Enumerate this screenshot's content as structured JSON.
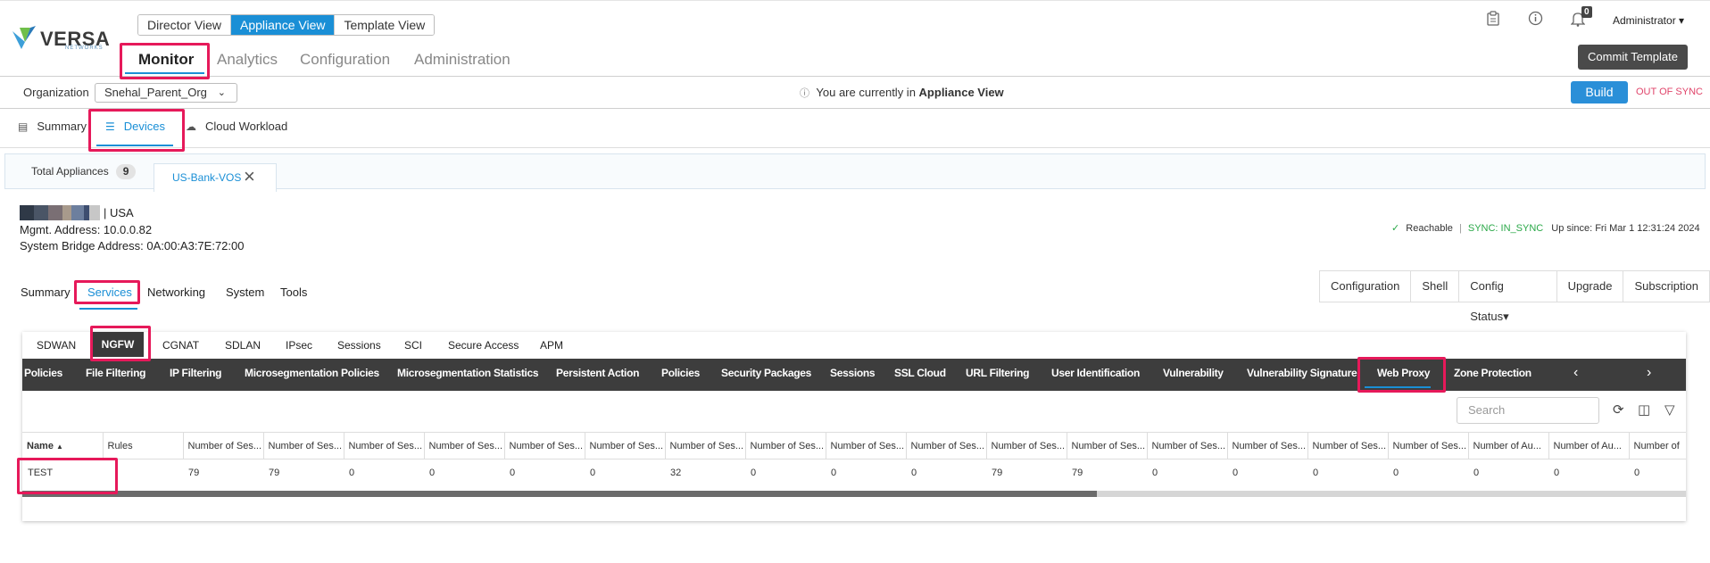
{
  "brand": {
    "name": "VERSA",
    "sub": "NETWORKS"
  },
  "view_toggle": [
    "Director View",
    "Appliance View",
    "Template View"
  ],
  "view_toggle_active": "Appliance View",
  "main_nav": [
    "Monitor",
    "Analytics",
    "Configuration",
    "Administration"
  ],
  "main_nav_active": "Monitor",
  "header": {
    "notifications_count": "0",
    "user": "Administrator ▾",
    "commit_button": "Commit Template"
  },
  "org_bar": {
    "label": "Organization",
    "selected_org": "Snehal_Parent_Org",
    "message_prefix": "You are currently in",
    "message_view": "Appliance View",
    "build_button": "Build",
    "sync_status": "OUT OF SYNC"
  },
  "section_tabs": [
    "Summary",
    "Devices",
    "Cloud Workload"
  ],
  "section_tab_active": "Devices",
  "device_tabs": {
    "total_label": "Total Appliances",
    "total_count": "9",
    "open_device": "US-Bank-VOS"
  },
  "device_info": {
    "location": "USA",
    "mgmt_address": "Mgmt. Address: 10.0.0.82",
    "bridge_address": "System Bridge Address: 0A:00:A3:7E:72:00",
    "reachable": "Reachable",
    "sync": "SYNC: IN_SYNC",
    "uptime": "Up since: Fri Mar 1 12:31:24 2024",
    "swatch_colors": [
      "#2f3947",
      "#4a5566",
      "#7a6f74",
      "#a89a8c",
      "#6d7f9e",
      "#3e4e70",
      "#c7c7c7"
    ]
  },
  "device_subtabs": [
    "Summary",
    "Services",
    "Networking",
    "System",
    "Tools"
  ],
  "device_subtab_active": "Services",
  "device_actions": [
    "Configuration",
    "Shell",
    "Config Status▾",
    "Upgrade",
    "Subscription"
  ],
  "service_tabs": [
    "SDWAN",
    "NGFW",
    "CGNAT",
    "SDLAN",
    "IPsec",
    "Sessions",
    "SCI",
    "Secure Access",
    "APM"
  ],
  "service_tab_active": "NGFW",
  "ngfw_tabs": [
    "Policies",
    "File Filtering",
    "IP Filtering",
    "Microsegmentation Policies",
    "Microsegmentation Statistics",
    "Persistent Action",
    "Policies",
    "Security Packages",
    "Sessions",
    "SSL Cloud",
    "URL Filtering",
    "User Identification",
    "Vulnerability",
    "Vulnerability Signature",
    "Web Proxy",
    "Zone Protection"
  ],
  "ngfw_tab_active": "Web Proxy",
  "search_placeholder": "Search",
  "table": {
    "columns": [
      "Name",
      "Rules",
      "Number of Ses...",
      "Number of Ses...",
      "Number of Ses...",
      "Number of Ses...",
      "Number of Ses...",
      "Number of Ses...",
      "Number of Ses...",
      "Number of Ses...",
      "Number of Ses...",
      "Number of Ses...",
      "Number of Ses...",
      "Number of Ses...",
      "Number of Ses...",
      "Number of Ses...",
      "Number of Ses...",
      "Number of Ses...",
      "Number of Au...",
      "Number of Au...",
      "Number of"
    ],
    "rows": [
      [
        "TEST",
        "",
        "79",
        "79",
        "0",
        "0",
        "0",
        "0",
        "32",
        "0",
        "0",
        "0",
        "79",
        "79",
        "0",
        "0",
        "0",
        "0",
        "0",
        "0",
        "0"
      ]
    ]
  }
}
